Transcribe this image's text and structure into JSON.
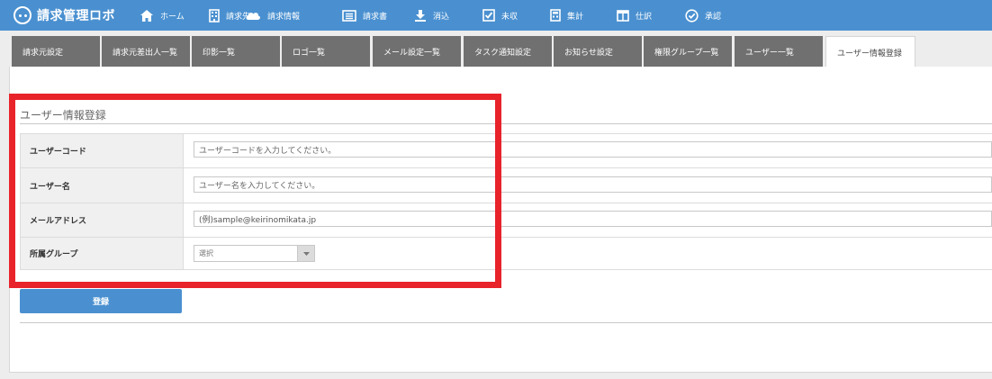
{
  "app": {
    "title": "請求管理ロボ"
  },
  "nav": [
    {
      "label": "ホーム",
      "icon": "home-icon"
    },
    {
      "label": "請求先",
      "icon": "building-icon"
    },
    {
      "label": "請求情報",
      "icon": "cloud-icon"
    },
    {
      "label": "請求書",
      "icon": "invoice-icon"
    },
    {
      "label": "消込",
      "icon": "download-icon"
    },
    {
      "label": "未収",
      "icon": "checkbox-icon"
    },
    {
      "label": "集計",
      "icon": "calculator-icon"
    },
    {
      "label": "仕訳",
      "icon": "journal-icon"
    },
    {
      "label": "承認",
      "icon": "check-circle-icon"
    }
  ],
  "tabs": [
    {
      "label": "請求元設定"
    },
    {
      "label": "請求元差出人一覧"
    },
    {
      "label": "印影一覧"
    },
    {
      "label": "ロゴ一覧"
    },
    {
      "label": "メール設定一覧"
    },
    {
      "label": "タスク通知設定"
    },
    {
      "label": "お知らせ設定"
    },
    {
      "label": "権限グループ一覧"
    },
    {
      "label": "ユーザー一覧"
    },
    {
      "label": "ユーザー情報登録"
    }
  ],
  "form": {
    "title": "ユーザー情報登録",
    "user_code": {
      "label": "ユーザーコード",
      "placeholder": "ユーザーコードを入力してください。"
    },
    "user_name": {
      "label": "ユーザー名",
      "placeholder": "ユーザー名を入力してください。"
    },
    "email": {
      "label": "メールアドレス",
      "placeholder": "(例)sample@keirinomikata.jp"
    },
    "group": {
      "label": "所属グループ",
      "selected": "選択"
    },
    "submit_label": "登録"
  },
  "colors": {
    "header": "#4a90d0",
    "highlight": "#e8232a",
    "tab": "#707070"
  }
}
